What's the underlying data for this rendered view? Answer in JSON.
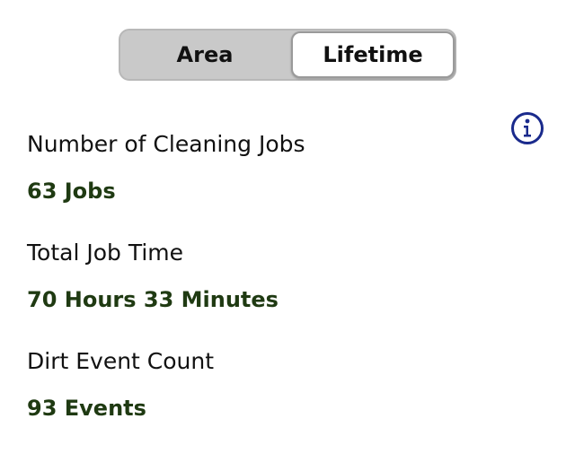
{
  "tabs": {
    "items": [
      {
        "label": "Area",
        "selected": false
      },
      {
        "label": "Lifetime",
        "selected": true
      }
    ]
  },
  "info": {
    "icon": "info-icon",
    "color": "#1a2a8c"
  },
  "stats": [
    {
      "label": "Number of Cleaning Jobs",
      "value": "63 Jobs"
    },
    {
      "label": "Total Job Time",
      "value": "70 Hours 33 Minutes"
    },
    {
      "label": "Dirt Event Count",
      "value": "93 Events"
    }
  ],
  "colors": {
    "value_text": "#1f3a12",
    "segment_track": "#c9c9c9",
    "segment_selected": "#ffffff"
  }
}
